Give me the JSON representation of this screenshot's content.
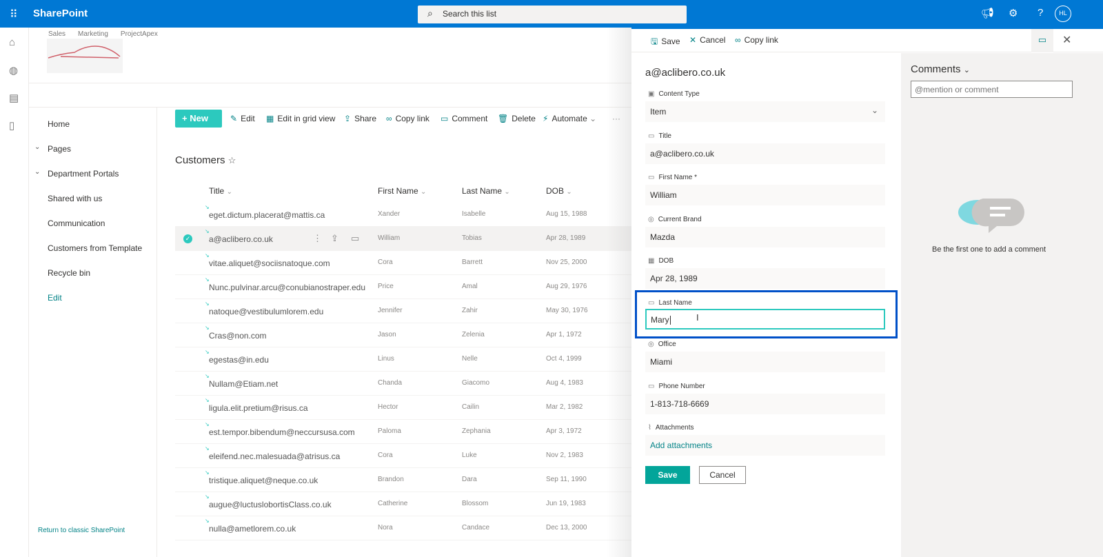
{
  "topbar": {
    "app_name": "SharePoint",
    "search_placeholder": "Search this list",
    "avatar_initials": "HL"
  },
  "site": {
    "nav": [
      "Sales",
      "Marketing",
      "ProjectApex"
    ]
  },
  "leftnav": {
    "items": [
      {
        "label": "Home"
      },
      {
        "label": "Pages",
        "expandable": true
      },
      {
        "label": "Department Portals",
        "expandable": true
      },
      {
        "label": "Shared with us"
      },
      {
        "label": "Communication"
      },
      {
        "label": "Customers from Template"
      },
      {
        "label": "Recycle bin"
      },
      {
        "label": "Edit"
      }
    ],
    "return_link": "Return to classic SharePoint"
  },
  "commands": {
    "new": "New",
    "edit": "Edit",
    "grid": "Edit in grid view",
    "share": "Share",
    "copy_link": "Copy link",
    "comment": "Comment",
    "delete": "Delete",
    "automate": "Automate"
  },
  "list": {
    "title": "Customers",
    "columns": [
      "Title",
      "First Name",
      "Last Name",
      "DOB"
    ],
    "rows": [
      [
        "eget.dictum.placerat@mattis.ca",
        "Xander",
        "Isabelle",
        "Aug 15, 1988"
      ],
      [
        "a@aclibero.co.uk",
        "William",
        "Tobias",
        "Apr 28, 1989"
      ],
      [
        "vitae.aliquet@sociisnatoque.com",
        "Cora",
        "Barrett",
        "Nov 25, 2000"
      ],
      [
        "Nunc.pulvinar.arcu@conubianostraper.edu",
        "Price",
        "Amal",
        "Aug 29, 1976"
      ],
      [
        "natoque@vestibulumlorem.edu",
        "Jennifer",
        "Zahir",
        "May 30, 1976"
      ],
      [
        "Cras@non.com",
        "Jason",
        "Zelenia",
        "Apr 1, 1972"
      ],
      [
        "egestas@in.edu",
        "Linus",
        "Nelle",
        "Oct 4, 1999"
      ],
      [
        "Nullam@Etiam.net",
        "Chanda",
        "Giacomo",
        "Aug 4, 1983"
      ],
      [
        "ligula.elit.pretium@risus.ca",
        "Hector",
        "Cailin",
        "Mar 2, 1982"
      ],
      [
        "est.tempor.bibendum@neccursusa.com",
        "Paloma",
        "Zephania",
        "Apr 3, 1972"
      ],
      [
        "eleifend.nec.malesuada@atrisus.ca",
        "Cora",
        "Luke",
        "Nov 2, 1983"
      ],
      [
        "tristique.aliquet@neque.co.uk",
        "Brandon",
        "Dara",
        "Sep 11, 1990"
      ],
      [
        "augue@luctuslobortisClass.co.uk",
        "Catherine",
        "Blossom",
        "Jun 19, 1983"
      ],
      [
        "nulla@ametlorem.co.uk",
        "Nora",
        "Candace",
        "Dec 13, 2000"
      ]
    ],
    "selected_row": 1
  },
  "panel": {
    "save": "Save",
    "cancel": "Cancel",
    "copy_link": "Copy link",
    "title": "a@aclibero.co.uk",
    "fields": [
      {
        "label": "Content Type",
        "value": "Item",
        "icon": "content-type-icon",
        "dropdown": true
      },
      {
        "label": "Title",
        "value": "a@aclibero.co.uk",
        "icon": "text-field-icon"
      },
      {
        "label": "First Name *",
        "value": "William",
        "icon": "text-field-icon"
      },
      {
        "label": "Current Brand",
        "value": "Mazda",
        "icon": "choice-icon"
      },
      {
        "label": "DOB",
        "value": "Apr 28, 1989",
        "icon": "calendar-icon"
      },
      {
        "label": "Last Name",
        "value": "Mary",
        "icon": "text-field-icon",
        "editing": true
      },
      {
        "label": "Office",
        "value": "Miami",
        "icon": "choice-icon"
      },
      {
        "label": "Phone Number",
        "value": "1-813-718-6669",
        "icon": "text-field-icon"
      },
      {
        "label": "Attachments",
        "value": "Add attachments",
        "icon": "paperclip-icon",
        "link": true
      }
    ],
    "save_button": "Save",
    "cancel_button": "Cancel"
  },
  "comments": {
    "title": "Comments",
    "placeholder": "@mention or comment",
    "empty": "Be the first one to add a comment"
  },
  "colors": {
    "suite_bar": "#0078d4",
    "accent": "#03a59a",
    "highlight": "#0050c8"
  }
}
